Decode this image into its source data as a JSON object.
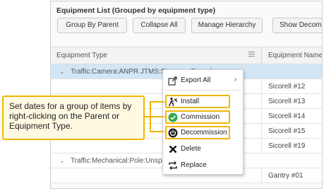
{
  "panel": {
    "title": "Equipment List (Grouped by equipment type)"
  },
  "toolbar": {
    "group_by_parent": "Group By Parent",
    "collapse_all": "Collapse All",
    "manage_hierarchy": "Manage Hierarchy",
    "show_decom": "Show Decom"
  },
  "grid": {
    "columns": [
      "Equipment Type",
      "Equipment Name"
    ],
    "groups": [
      {
        "label": "Traffic:Camera:ANPR JTMS:Siemens Sicorell (5)"
      },
      {
        "label": "Traffic:Mechanical:Pole:Unspecified"
      }
    ],
    "names": [
      "Sicorell #12",
      "Sicorell #13",
      "Sicorell #14",
      "Sicorell #15",
      "Sicorell #19",
      "Gantry #01"
    ]
  },
  "context_menu": {
    "items": [
      {
        "label": "Export All",
        "icon": "export-icon",
        "submenu": true
      },
      {
        "label": "Install",
        "icon": "install-icon"
      },
      {
        "label": "Commission",
        "icon": "check-circle-icon",
        "color": "#2eaa4a"
      },
      {
        "label": "Decommission",
        "icon": "power-icon"
      },
      {
        "label": "Delete",
        "icon": "close-icon"
      },
      {
        "label": "Replace",
        "icon": "replace-icon"
      }
    ],
    "highlight_color": "#f2b600"
  },
  "callout": {
    "text": "Set dates for a group of items by right-clicking on the Parent or Equipment Type."
  }
}
